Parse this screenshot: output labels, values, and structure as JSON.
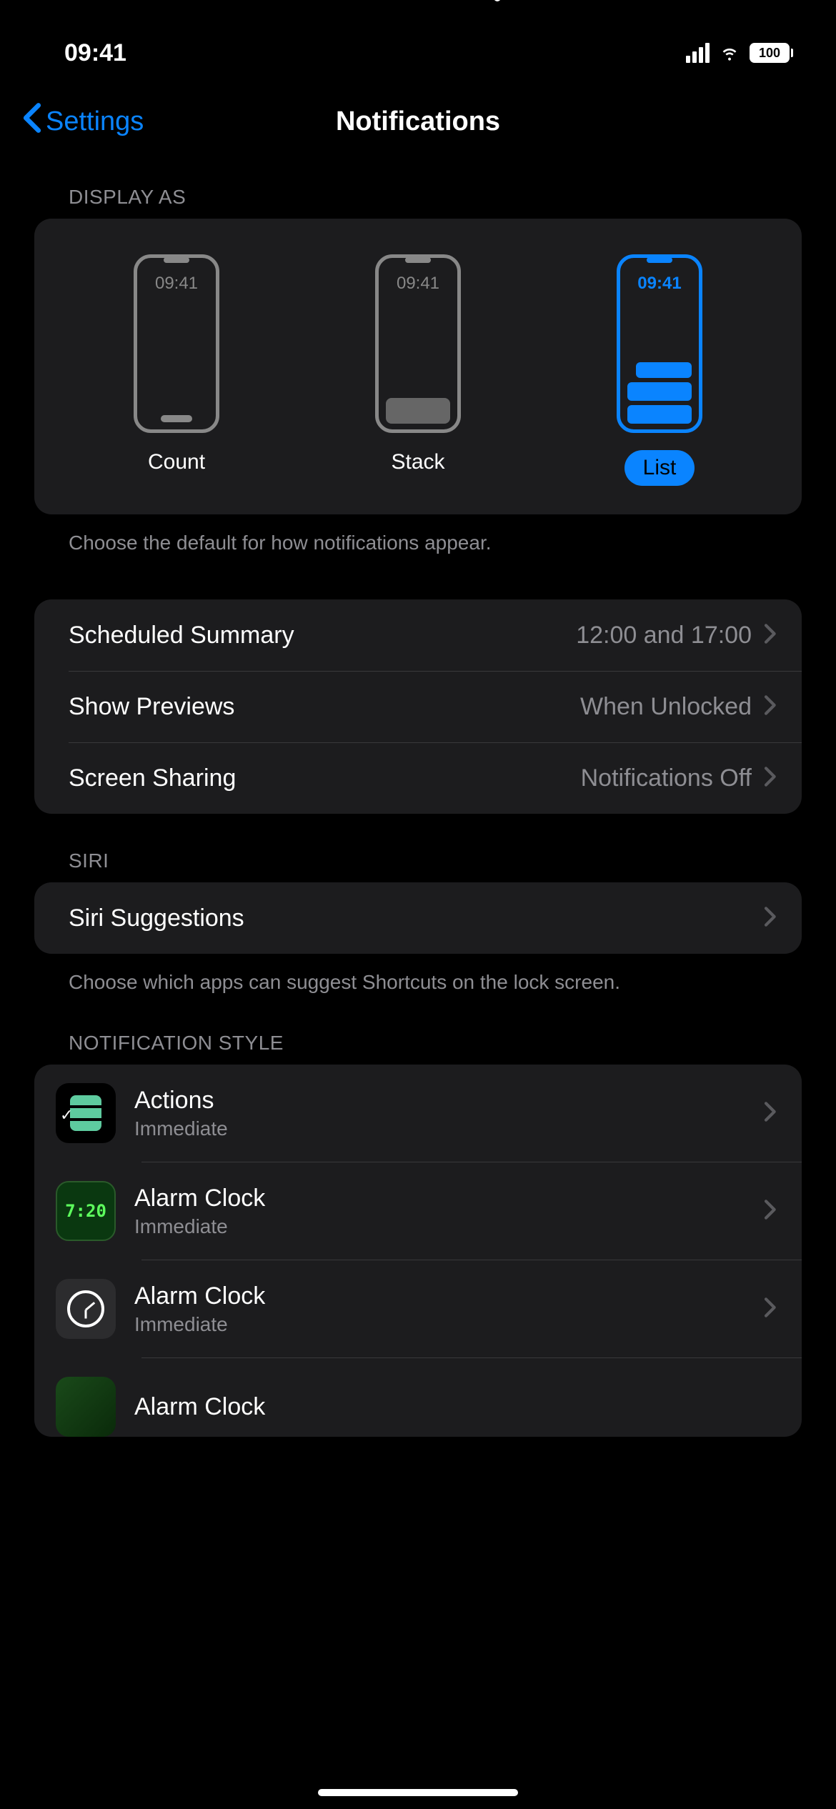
{
  "statusBar": {
    "time": "09:41",
    "battery": "100"
  },
  "nav": {
    "back": "Settings",
    "title": "Notifications"
  },
  "displayAs": {
    "header": "DISPLAY AS",
    "phoneTime": "09:41",
    "options": {
      "count": "Count",
      "stack": "Stack",
      "list": "List"
    },
    "footer": "Choose the default for how notifications appear."
  },
  "settings": {
    "scheduledSummary": {
      "title": "Scheduled Summary",
      "value": "12:00 and 17:00"
    },
    "showPreviews": {
      "title": "Show Previews",
      "value": "When Unlocked"
    },
    "screenSharing": {
      "title": "Screen Sharing",
      "value": "Notifications Off"
    }
  },
  "siri": {
    "header": "SIRI",
    "suggestions": "Siri Suggestions",
    "footer": "Choose which apps can suggest Shortcuts on the lock screen."
  },
  "notificationStyle": {
    "header": "NOTIFICATION STYLE",
    "apps": [
      {
        "name": "Actions",
        "sub": "Immediate"
      },
      {
        "name": "Alarm Clock",
        "sub": "Immediate"
      },
      {
        "name": "Alarm Clock",
        "sub": "Immediate"
      },
      {
        "name": "Alarm Clock",
        "sub": ""
      }
    ],
    "alarmDigits": "7:20"
  }
}
